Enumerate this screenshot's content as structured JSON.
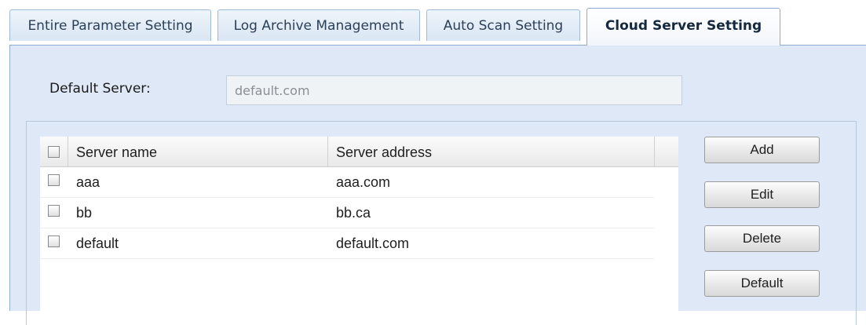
{
  "tabs": [
    {
      "label": "Entire Parameter Setting",
      "active": false
    },
    {
      "label": "Log Archive Management",
      "active": false
    },
    {
      "label": "Auto Scan Setting",
      "active": false
    },
    {
      "label": "Cloud Server Setting",
      "active": true
    }
  ],
  "default_server": {
    "label": "Default Server:",
    "value": "default.com"
  },
  "grid": {
    "columns": [
      "Server name",
      "Server address"
    ],
    "rows": [
      {
        "name": "aaa",
        "address": "aaa.com"
      },
      {
        "name": "bb",
        "address": "bb.ca"
      },
      {
        "name": "default",
        "address": "default.com"
      }
    ]
  },
  "buttons": {
    "add": "Add",
    "edit": "Edit",
    "delete": "Delete",
    "default": "Default"
  },
  "colors": {
    "panel_bg": "#dfe8f6",
    "tab_border": "#8eaccc"
  }
}
